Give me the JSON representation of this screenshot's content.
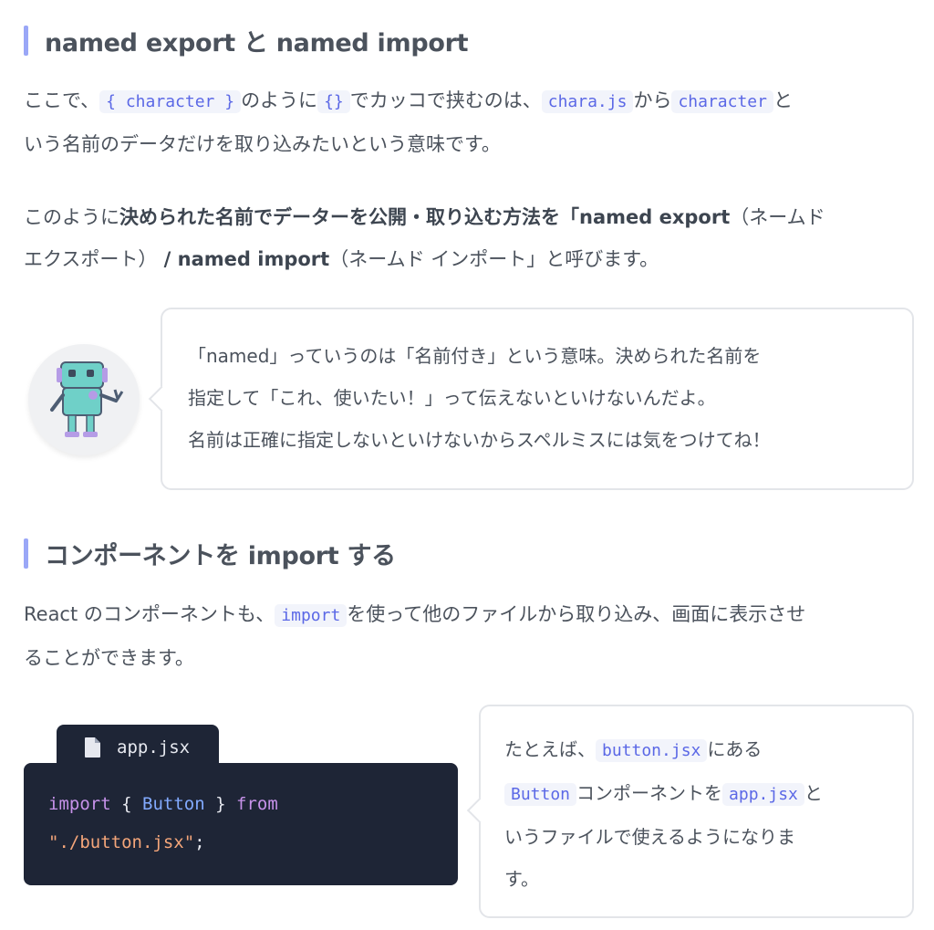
{
  "section1": {
    "heading": "named export と named import",
    "p1": {
      "t1": "ここで、",
      "c1": "{ character }",
      "t2": "のように",
      "c2": "{}",
      "t3": "でカッコで挟むのは、",
      "c3": "chara.js",
      "t4": "から",
      "c4": "character",
      "t5": "と",
      "t6": "いう名前のデータだけを取り込みたいという意味です。"
    },
    "p2": {
      "t1": "このように",
      "b1": "決められた名前でデーターを公開・取り込む方法を「named export",
      "t2": "（ネームド",
      "t3": "エクスポート）",
      "b2": " / named import",
      "t4": "（ネームド インポート」と呼びます。"
    }
  },
  "callout": {
    "line1": "「named」っていうのは「名前付き」という意味。決められた名前を",
    "line2": "指定して「これ、使いたい！」って伝えないといけないんだよ。",
    "line3": "名前は正確に指定しないといけないからスペルミスには気をつけてね！"
  },
  "section2": {
    "heading": "コンポーネントを import する",
    "p1": {
      "t1": "React のコンポーネントも、",
      "c1": "import",
      "t2": "を使って他のファイルから取り込み、画面に表示させ",
      "t3": "ることができます。"
    }
  },
  "codefile": {
    "filename": "app.jsx",
    "kw_import": "import",
    "brace_open": "{",
    "ident": "Button",
    "brace_close": "}",
    "kw_from": "from",
    "string": "\"./button.jsx\"",
    "semicolon": ";"
  },
  "explain": {
    "t1": "たとえば、",
    "c1": "button.jsx",
    "t2": "にある",
    "c2": "Button",
    "t3": "コンポーネントを",
    "c3": "app.jsx",
    "t4": "と",
    "t5": "いうファイルで使えるようになりま",
    "t6": "す。"
  },
  "colors": {
    "accent": "#9aa7f7",
    "code_text": "#5b68e6",
    "code_bg": "#f2f4fb",
    "editor_bg": "#1e2536",
    "keyword": "#c792ea",
    "identifier": "#82aaff",
    "string": "#f5a67a"
  },
  "icons": [
    "file-icon",
    "robot-mascot"
  ]
}
